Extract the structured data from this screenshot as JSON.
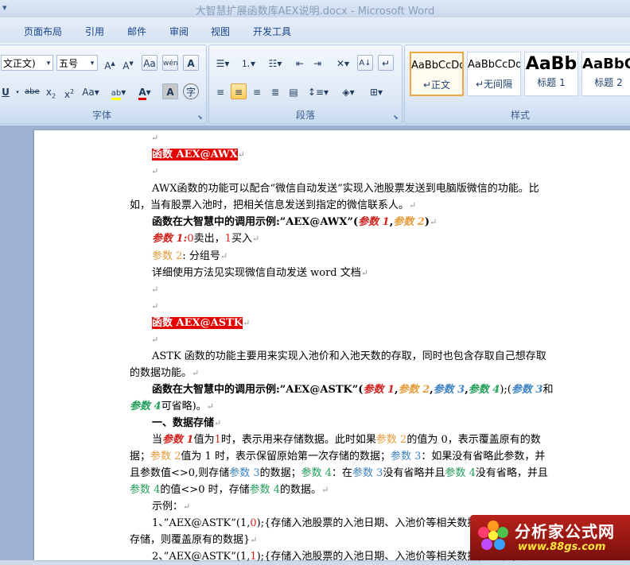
{
  "window": {
    "title": "大智慧扩展函数库AEX说明.docx - Microsoft Word"
  },
  "tabs": [
    "页面布局",
    "引用",
    "邮件",
    "审阅",
    "视图",
    "开发工具"
  ],
  "font_group": {
    "font_name": "文正文)",
    "font_size": "五号",
    "label": "字体",
    "buttons": [
      "A^",
      "A˅",
      "Aa",
      "wén",
      "A",
      "U",
      "abe",
      "x₂",
      "x²",
      "Aa",
      "ab",
      "A",
      "A",
      "字"
    ]
  },
  "paragraph_group": {
    "label": "段落"
  },
  "styles_group": {
    "label": "样式",
    "styles": [
      {
        "sample": "AaBbCcDd",
        "name": "↵正文"
      },
      {
        "sample": "AaBbCcDd",
        "name": "↵无间隔"
      },
      {
        "sample": "AaBb",
        "name": "标题 1"
      },
      {
        "sample": "AaBbC",
        "name": "标题 2"
      }
    ]
  },
  "document": {
    "para_mark": "↵",
    "h1": "函数 AEX@AWX",
    "awx_desc_1": "AWX函数的功能可以配合“微信自动发送”实现入池股票发送到电脑版微信的功能。比",
    "awx_desc_2": "如，当有股票入池时，把相关信息发送到指定的微信联系人。",
    "awx_example_prefix": "函数在大智慧中的调用示例:”AEX@AWX”(",
    "awx_param1_tag": "参数 1",
    "awx_comma": ",",
    "awx_param2_tag": "参数 2",
    "awx_close": ")",
    "p1_label": "参数 1:",
    "p1_zero": "0",
    "p1_sell": "卖出，",
    "p1_one": "1",
    "p1_buy": "买入",
    "p2_label": "参数 2",
    "p2_text": ": 分组号",
    "awx_detail": "详细使用方法见实现微信自动发送 word 文档",
    "h2": "函数 AEX@ASTK",
    "astk_desc_1": "ASTK 函数的功能主要用来实现入池价和入池天数的存取，同时也包含存取自己想存取",
    "astk_desc_2": "的数据功能。",
    "astk_example_prefix": "函数在大智慧中的调用示例:”AEX@ASTK”(",
    "tag_p1": "参数 1",
    "tag_p2": "参数 2",
    "tag_p3": "参数 3",
    "tag_p4": "参数 4",
    "astk_example_mid": ");(",
    "astk_and": "和",
    "astk_optional": "可省略)。",
    "sec1": "一、数据存储",
    "d1_a": "当",
    "d1_b": "值为",
    "d1_one": "1",
    "d1_c": "时，表示用来存储数据。此时如果",
    "d1_d": "的值为 0，表示覆盖原有的数",
    "d2_a": "据；",
    "d2_b": "值为 1 时，表示保留原始第一次存储的数据；",
    "d2_c": "：如果没有省略此参数，并",
    "d3_a": "且参数值<>0,则存储",
    "d3_b": "的数据；",
    "d3_c": "：在",
    "d3_d": "没有省略并且",
    "d3_e": "没有省略，并且",
    "d4_a": "的值<>0 时，存储",
    "d4_b": "的数据。",
    "example_label": "示例：",
    "ex1_a": "1、”AEX@ASTK”(1,",
    "ex1_zero": "0",
    "ex1_b": ");{存储入池股票的入池日期、入池价等相关数据，如果原来已经",
    "ex1_c": "存储，则覆盖原有的数据}",
    "ex2_a": "2、”AEX@ASTK”(1,",
    "ex2_one": "1",
    "ex2_b": ");{存储入池股票的入池日期、入池价等相关数据，如果原来已经"
  },
  "watermark": {
    "title": "分析家公式网",
    "url": "www.88gs.com"
  },
  "colors": {
    "heading_bg": "#e40000",
    "param1": "#d2231f",
    "param2": "#e69b3c",
    "param3": "#3e83c2",
    "param4": "#22a05a"
  }
}
